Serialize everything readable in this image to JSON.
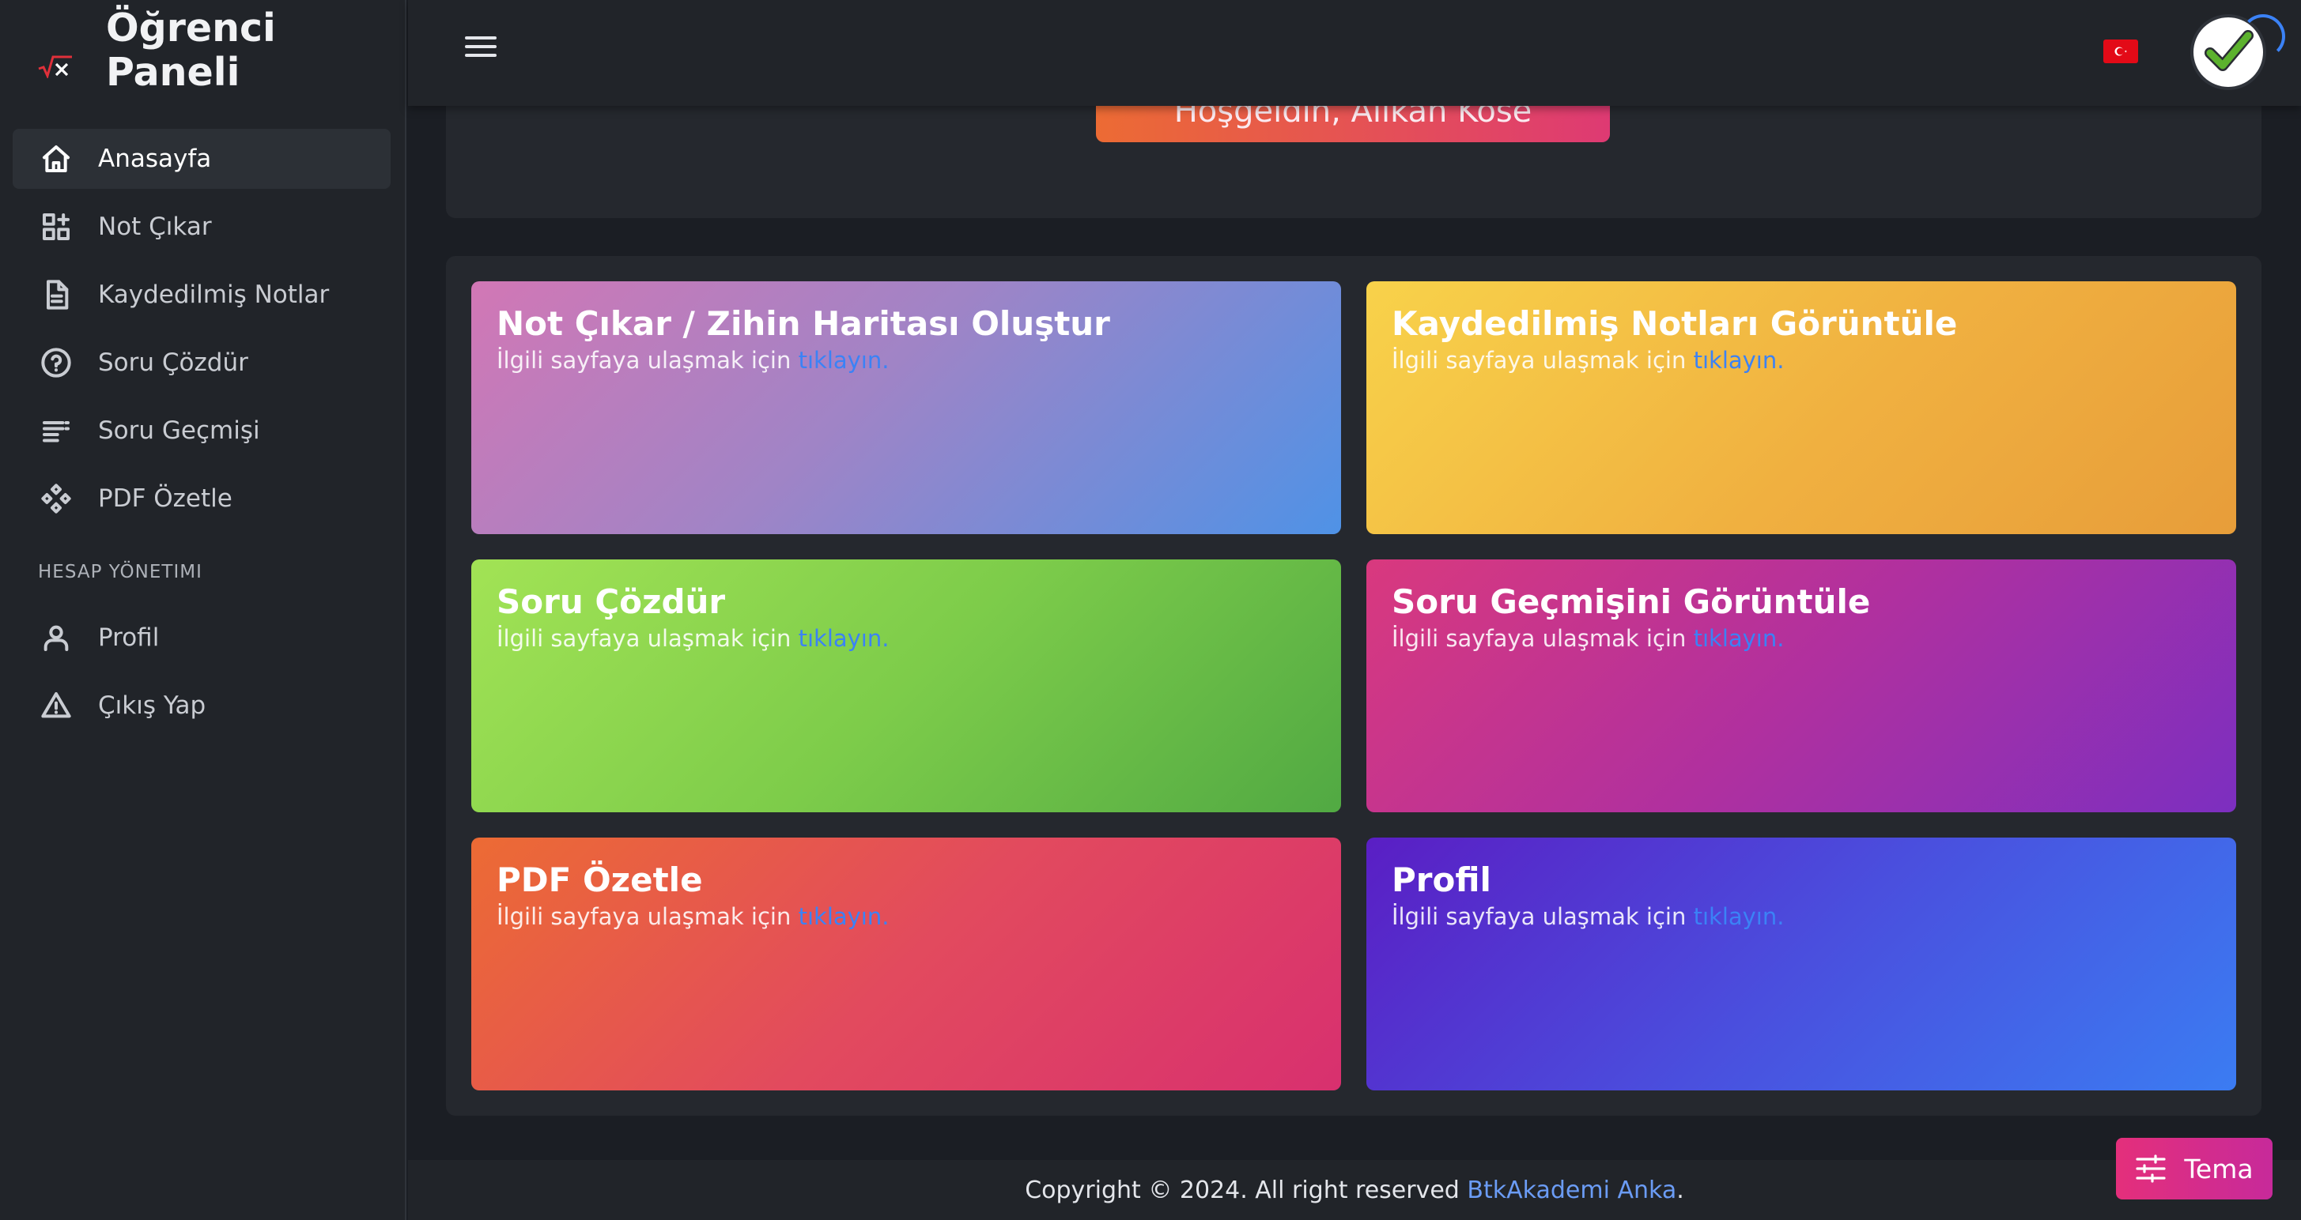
{
  "brand": {
    "title_line1": "Öğrenci",
    "title_line2": "Paneli",
    "logo_icon": "sqrt-x-logo-icon"
  },
  "sidebar": {
    "items": [
      {
        "label": "Anasayfa",
        "icon": "home-icon",
        "active": true
      },
      {
        "label": "Not Çıkar",
        "icon": "grid-plus-icon"
      },
      {
        "label": "Kaydedilmiş Notlar",
        "icon": "document-icon"
      },
      {
        "label": "Soru Çözdür",
        "icon": "question-circle-icon"
      },
      {
        "label": "Soru Geçmişi",
        "icon": "list-icon"
      },
      {
        "label": "PDF Özetle",
        "icon": "move-arrows-icon"
      }
    ],
    "section_label": "HESAP YÖNETIMI",
    "account_items": [
      {
        "label": "Profil",
        "icon": "user-icon"
      },
      {
        "label": "Çıkış Yap",
        "icon": "warning-triangle-icon"
      }
    ]
  },
  "topbar": {
    "menu_icon": "hamburger-menu-icon",
    "language_flag": "turkey-flag-icon",
    "avatar_icon": "check-avatar-icon"
  },
  "welcome": {
    "text": "Hoşgeldin, Alikan Köse"
  },
  "cards": [
    {
      "title": "Not Çıkar / Zihin Haritası Oluştur",
      "sub_prefix": "İlgili sayfaya ulaşmak için",
      "link": "tıklayın."
    },
    {
      "title": "Kaydedilmiş Notları Görüntüle",
      "sub_prefix": "İlgili sayfaya ulaşmak için",
      "link": "tıklayın."
    },
    {
      "title": "Soru Çözdür",
      "sub_prefix": "İlgili sayfaya ulaşmak için",
      "link": "tıklayın."
    },
    {
      "title": "Soru Geçmişini Görüntüle",
      "sub_prefix": "İlgili sayfaya ulaşmak için",
      "link": "tıklayın."
    },
    {
      "title": "PDF Özetle",
      "sub_prefix": "İlgili sayfaya ulaşmak için",
      "link": "tıklayın."
    },
    {
      "title": "Profil",
      "sub_prefix": "İlgili sayfaya ulaşmak için",
      "link": "tıklayın."
    }
  ],
  "footer": {
    "prefix": "Copyright © 2024. All right reserved",
    "link": "BtkAkademi Anka",
    "suffix": "."
  },
  "theme_button": {
    "label": "Tema",
    "icon": "sliders-icon"
  },
  "colors": {
    "link_blue": "#3b82f6",
    "background": "#1b1e24",
    "panel": "#25282e"
  }
}
